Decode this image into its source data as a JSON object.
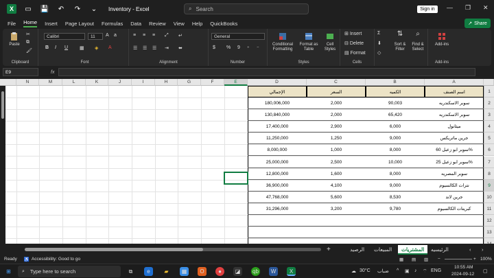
{
  "window": {
    "title": "Inventory  -  Excel",
    "search_placeholder": "Search",
    "signin_label": "Sign in"
  },
  "menu": [
    "File",
    "Home",
    "Insert",
    "Page Layout",
    "Formulas",
    "Data",
    "Review",
    "View",
    "Help",
    "QuickBooks"
  ],
  "share_label": "Share",
  "ribbon": {
    "clipboard": {
      "paste": "Paste",
      "label": "Clipboard"
    },
    "font": {
      "name": "Calibri",
      "size": "11",
      "label": "Font"
    },
    "alignment": {
      "label": "Alignment"
    },
    "number": {
      "format": "General",
      "label": "Number"
    },
    "styles": {
      "conditional": "Conditional Formatting",
      "format_table": "Format as Table",
      "cell_styles": "Cell Styles",
      "label": "Styles"
    },
    "cells": {
      "insert": "Insert",
      "delete": "Delete",
      "format": "Format",
      "label": "Cells"
    },
    "editing": {
      "sort": "Sort & Filter",
      "find": "Find & Select",
      "label": "Editing"
    },
    "addins": {
      "addins": "Add-ins",
      "label": "Add-ins"
    }
  },
  "formula_bar": {
    "name_box": "E9",
    "fx": "fx",
    "value": ""
  },
  "columns": [
    "N",
    "M",
    "L",
    "K",
    "J",
    "I",
    "H",
    "G",
    "F",
    "E",
    "D",
    "C",
    "B",
    "A"
  ],
  "selected_column": "E",
  "rows": [
    "1",
    "2",
    "3",
    "4",
    "5",
    "6",
    "7",
    "8",
    "9",
    "10",
    "11",
    "12",
    "13",
    "14"
  ],
  "selected_row": "9",
  "table": {
    "headers": {
      "a": "اسم الصنف",
      "b": "الكميه",
      "c": "السعر",
      "d": "الإجمالي"
    },
    "rows": [
      {
        "a": "سوبر الاسكندريه",
        "b": "90,003",
        "c": "2,000",
        "d": "180,006,000"
      },
      {
        "a": "سوبر الاسكندريه",
        "b": "65,420",
        "c": "2,000",
        "d": "130,840,000"
      },
      {
        "a": "ميثانول",
        "b": "6,000",
        "c": "2,900",
        "d": "17,400,000"
      },
      {
        "a": "جرين ماتريكس",
        "b": "9,000",
        "c": "1,250",
        "d": "11,250,000"
      },
      {
        "a": "سوبر ابو زعبل 60%",
        "b": "8,000",
        "c": "1,000",
        "d": "8,000,000"
      },
      {
        "a": "سوبر ابو زعبل 25%",
        "b": "10,000",
        "c": "2,500",
        "d": "25,000,000"
      },
      {
        "a": "سوبر المصريه",
        "b": "8,000",
        "c": "1,600",
        "d": "12,800,000"
      },
      {
        "a": "نترات الكالسيوم",
        "b": "9,000",
        "c": "4,100",
        "d": "36,900,000"
      },
      {
        "a": "جرين لاند",
        "b": "8,530",
        "c": "5,600",
        "d": "47,768,000"
      },
      {
        "a": "كبريتات الكالسيوم",
        "b": "9,780",
        "c": "3,200",
        "d": "31,296,000"
      }
    ]
  },
  "sheets": {
    "main": "الرئيسيه",
    "purchases": "المشتريات",
    "sales": "المبيعات",
    "balance": "الرصيد",
    "add": "+"
  },
  "status": {
    "ready": "Ready",
    "accessibility": "Accessibility: Good to go",
    "zoom": "100%"
  },
  "taskbar": {
    "search": "Type here to search",
    "temp": "30°C",
    "weather": "ضباب",
    "lang": "ENG",
    "time": "10:55 AM",
    "date": "2024-09-12"
  }
}
